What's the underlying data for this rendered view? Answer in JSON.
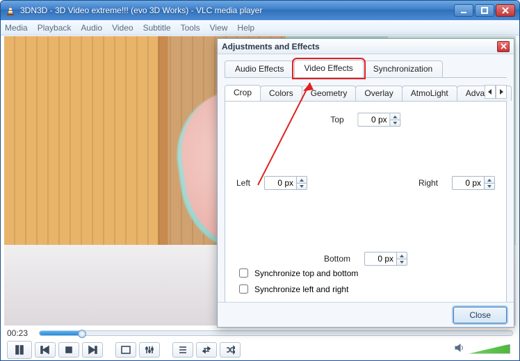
{
  "window": {
    "title": "3DN3D - 3D Video extreme!!! (evo 3D Works) - VLC media player"
  },
  "menubar": [
    "Media",
    "Playback",
    "Audio",
    "Video",
    "Subtitle",
    "Tools",
    "View",
    "Help"
  ],
  "player": {
    "time_elapsed": "00:23"
  },
  "dialog": {
    "title": "Adjustments and Effects",
    "close_button": "Close",
    "tabs": [
      {
        "label": "Audio Effects",
        "active": false
      },
      {
        "label": "Video Effects",
        "active": true
      },
      {
        "label": "Synchronization",
        "active": false
      }
    ],
    "subtabs": [
      {
        "label": "Crop",
        "active": true
      },
      {
        "label": "Colors"
      },
      {
        "label": "Geometry"
      },
      {
        "label": "Overlay"
      },
      {
        "label": "AtmoLight"
      },
      {
        "label": "Advanced"
      }
    ],
    "crop": {
      "top": {
        "label": "Top",
        "value": "0 px"
      },
      "left": {
        "label": "Left",
        "value": "0 px"
      },
      "right": {
        "label": "Right",
        "value": "0 px"
      },
      "bottom": {
        "label": "Bottom",
        "value": "0 px"
      },
      "sync_tb": {
        "label": "Synchronize top and bottom",
        "checked": false
      },
      "sync_lr": {
        "label": "Synchronize left and right",
        "checked": false
      }
    }
  },
  "annotation": {
    "color": "#e02020"
  }
}
